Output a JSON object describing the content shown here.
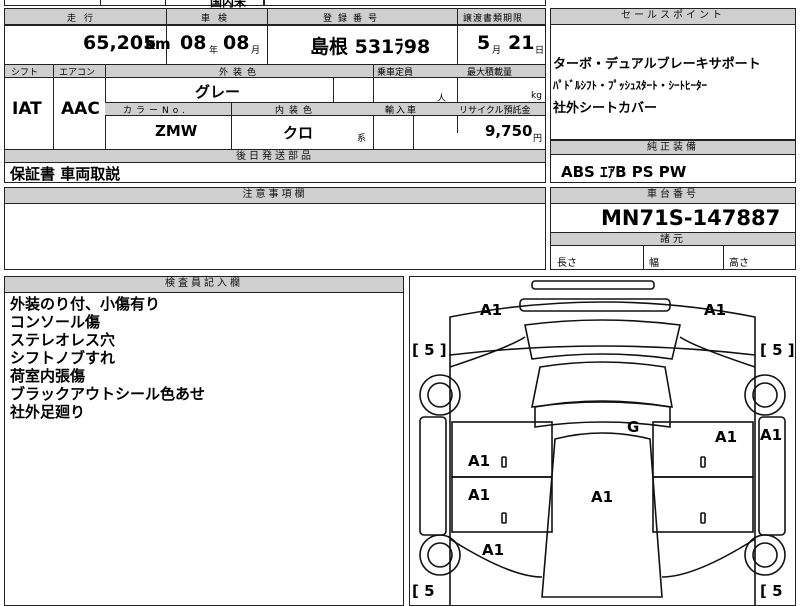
{
  "top_cut": {
    "left": "",
    "right": "国内未"
  },
  "main_table": {
    "headers": {
      "mileage": "走行",
      "inspection": "車検",
      "registration": "登録番号",
      "transfer_deadline": "譲渡書類期限",
      "shift": "シフト",
      "aircon": "エアコン",
      "exterior_color": "外装色",
      "capacity": "乗車定員",
      "load": "最大積載量",
      "color_no": "カラーNo.",
      "interior_color": "内装色",
      "import": "輸入車",
      "recycle": "リサイクル預託金",
      "accessories": "後日発送部品"
    },
    "mileage_value": "65,205",
    "mileage_unit": "km",
    "inspection_year": "08",
    "inspection_year_unit": "年",
    "inspection_month": "08",
    "inspection_month_unit": "月",
    "registration_value": "島根 531ﾗ98",
    "transfer_month": "5",
    "transfer_month_unit": "月",
    "transfer_day": "21",
    "transfer_day_unit": "日",
    "shift_value": "IAT",
    "aircon_value": "AAC",
    "exterior_color_value": "グレー",
    "capacity_unit": "人",
    "load_unit": "kg",
    "color_no_value": "ZMW",
    "interior_color_value": "クロ",
    "interior_color_unit": "系",
    "recycle_value": "9,750",
    "recycle_unit": "円",
    "accessories_value": "保証書 車両取説"
  },
  "sales_points": {
    "header": "セールスポイント",
    "lines": [
      "ターボ・デュアルブレーキサポート",
      "ﾊﾟﾄﾞﾙｼﾌﾄ・ﾌﾟｯｼｭｽﾀｰﾄ・ｼｰﾄﾋｰﾀｰ",
      "社外シートカバー"
    ]
  },
  "standard_equipment": {
    "header": "純正装備",
    "value": "ABS ｴｱB PS PW"
  },
  "cautions": {
    "header": "注意事項欄",
    "value": ""
  },
  "chassis": {
    "header": "車台番号",
    "value": "MN71S-147887",
    "dimensions_header": "諸元",
    "length": "長さ",
    "width": "幅",
    "height": "高さ"
  },
  "inspector_notes": {
    "header": "検査員記入欄",
    "lines": [
      "外装のり付、小傷有り",
      "コンソール傷",
      "ステレオレス穴",
      "シフトノブすれ",
      "荷室内張傷",
      "ブラックアウトシール色あせ",
      "社外足廻り"
    ]
  },
  "diagram": {
    "tire_marks": [
      "[ 5 ]",
      "[ 5 ]",
      "[ 5",
      "[ 5"
    ],
    "codes": [
      "A1",
      "A1",
      "G",
      "A1",
      "A1",
      "A1",
      "A1",
      "A1",
      "A1"
    ]
  }
}
